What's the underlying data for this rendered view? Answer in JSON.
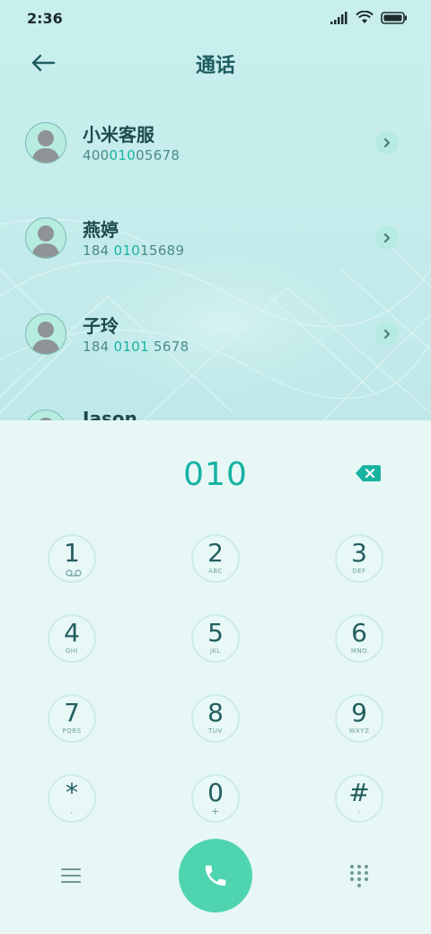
{
  "status": {
    "time": "2:36"
  },
  "header": {
    "title": "通话"
  },
  "contacts": [
    {
      "name": "小米客服",
      "num_pre": "400",
      "num_hl": "010",
      "num_post": "05678"
    },
    {
      "name": "燕婷",
      "num_pre": "184 ",
      "num_hl": "010",
      "num_post": "15689"
    },
    {
      "name": "子玲",
      "num_pre": "184 ",
      "num_hl": "0101",
      "num_post": " 5678"
    },
    {
      "name": "Jason"
    }
  ],
  "dialer": {
    "display": "010",
    "keys": [
      {
        "digit": "1",
        "letters": ""
      },
      {
        "digit": "2",
        "letters": "ABC"
      },
      {
        "digit": "3",
        "letters": "DEF"
      },
      {
        "digit": "4",
        "letters": "GHI"
      },
      {
        "digit": "5",
        "letters": "JKL"
      },
      {
        "digit": "6",
        "letters": "MNO"
      },
      {
        "digit": "7",
        "letters": "PQRS"
      },
      {
        "digit": "8",
        "letters": "TUV"
      },
      {
        "digit": "9",
        "letters": "WXYZ"
      },
      {
        "digit": "*",
        "letters": ","
      },
      {
        "digit": "0",
        "letters": "+"
      },
      {
        "digit": "#",
        "letters": ";"
      }
    ]
  },
  "colors": {
    "accent": "#19b3a2",
    "call_button": "#4fd4b0",
    "title": "#1f5d60"
  },
  "icons": [
    "back-arrow-icon",
    "signal-icon",
    "wifi-icon",
    "battery-icon",
    "chevron-right-icon",
    "backspace-icon",
    "voicemail-icon",
    "menu-icon",
    "phone-icon",
    "dialpad-icon"
  ]
}
